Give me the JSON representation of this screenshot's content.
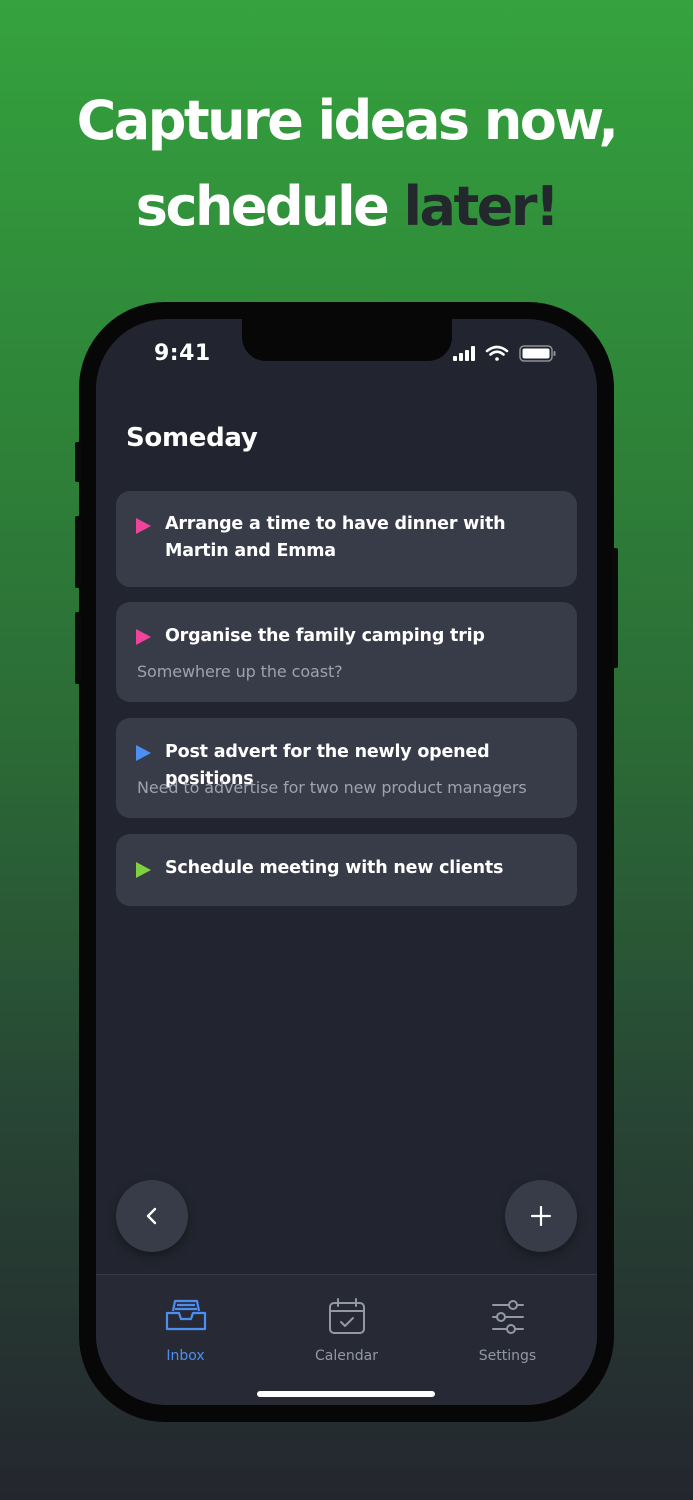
{
  "headline": {
    "line1": "Capture ideas now,",
    "line2_light": "schedule ",
    "line2_dark": "later!"
  },
  "status_bar": {
    "time": "9:41"
  },
  "page": {
    "title": "Someday"
  },
  "tasks": [
    {
      "title": "Arrange a time to have dinner with Martin and Emma",
      "note": "",
      "color": "#f0439b"
    },
    {
      "title": "Organise the family camping trip",
      "note": "Somewhere up the coast?",
      "color": "#f0439b"
    },
    {
      "title": "Post advert for the newly opened positions",
      "note": "Need to advertise for two new product managers",
      "color": "#4c8ff0"
    },
    {
      "title": "Schedule meeting with new clients",
      "note": "",
      "color": "#7ed23e"
    }
  ],
  "buttons": {
    "back_icon": "chevron-left-icon",
    "add_icon": "plus-icon"
  },
  "tabs": [
    {
      "label": "Inbox",
      "icon": "inbox-icon",
      "active": true,
      "color": "#4c8ff0"
    },
    {
      "label": "Calendar",
      "icon": "calendar-icon",
      "active": false,
      "color": "#9498a4"
    },
    {
      "label": "Settings",
      "icon": "sliders-icon",
      "active": false,
      "color": "#9498a4"
    }
  ]
}
